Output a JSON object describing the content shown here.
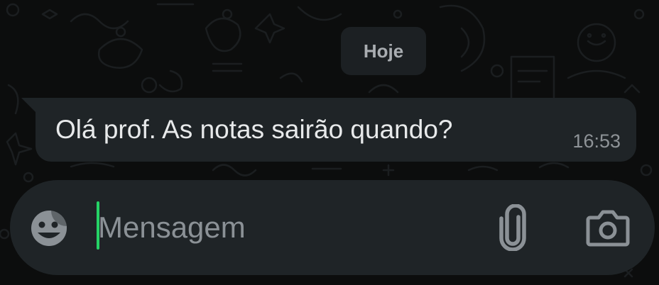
{
  "chat": {
    "date_separator": "Hoje",
    "messages": [
      {
        "text": "Olá prof. As notas sairão quando?",
        "time": "16:53"
      }
    ]
  },
  "composer": {
    "placeholder": "Mensagem",
    "value": "",
    "left_icon": "sticker-icon",
    "right_icons": [
      "paperclip-icon",
      "camera-icon"
    ]
  },
  "colors": {
    "background": "#0c0d0d",
    "bubble": "#1f2427",
    "cursor": "#25d366",
    "text": "#e7e9ea",
    "muted": "#8e9397"
  }
}
